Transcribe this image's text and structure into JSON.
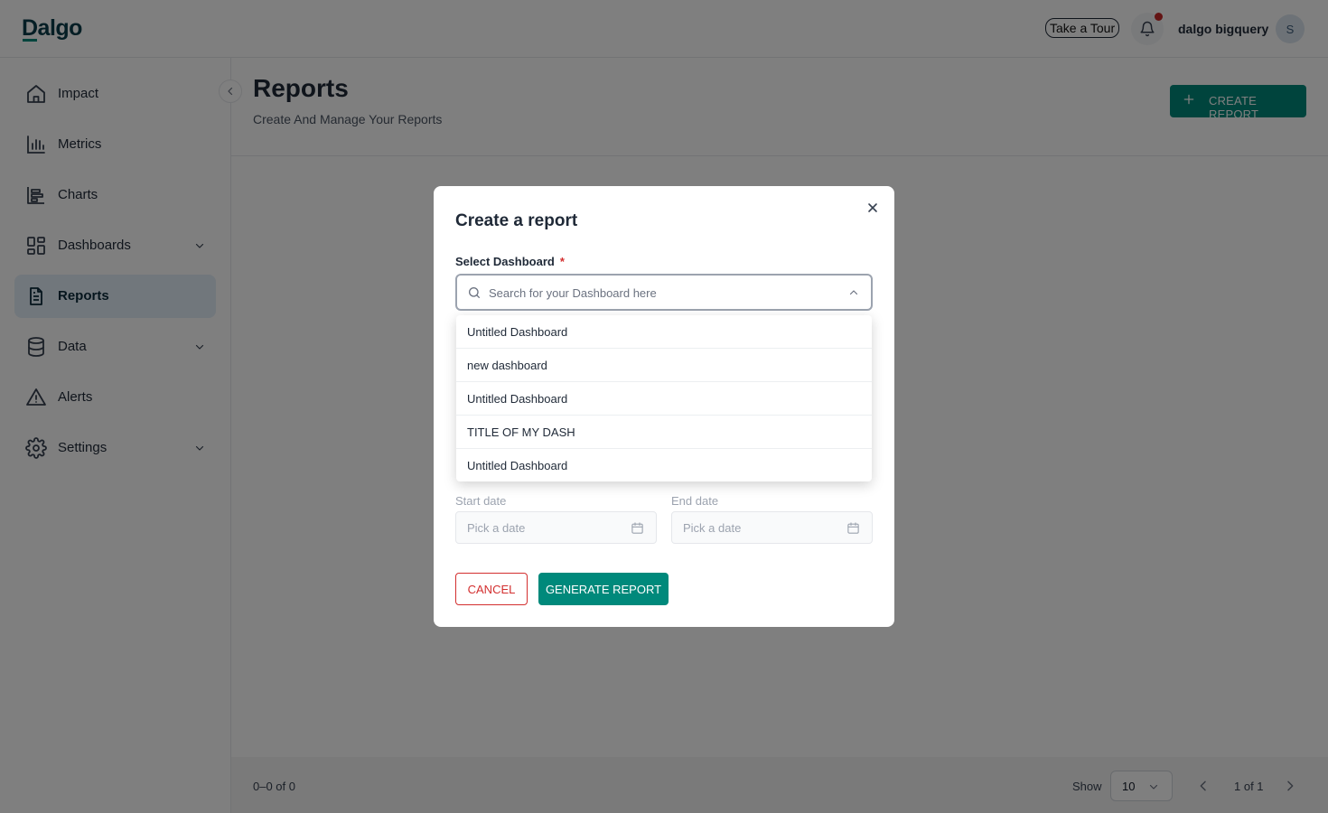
{
  "app": {
    "logo": "Dalgo"
  },
  "header": {
    "tour_label": "Take a Tour",
    "user_name": "dalgo bigquery",
    "avatar_initial": "S"
  },
  "sidebar": {
    "items": [
      {
        "label": "Impact",
        "icon": "home-icon",
        "has_chevron": false,
        "active": false
      },
      {
        "label": "Metrics",
        "icon": "bar-chart-icon",
        "has_chevron": false,
        "active": false
      },
      {
        "label": "Charts",
        "icon": "chart-icon",
        "has_chevron": false,
        "active": false
      },
      {
        "label": "Dashboards",
        "icon": "dashboard-icon",
        "has_chevron": true,
        "active": false
      },
      {
        "label": "Reports",
        "icon": "document-icon",
        "has_chevron": false,
        "active": true
      },
      {
        "label": "Data",
        "icon": "database-icon",
        "has_chevron": true,
        "active": false
      },
      {
        "label": "Alerts",
        "icon": "alert-icon",
        "has_chevron": false,
        "active": false
      },
      {
        "label": "Settings",
        "icon": "gear-icon",
        "has_chevron": true,
        "active": false
      }
    ]
  },
  "main": {
    "title": "Reports",
    "subtitle": "Create And Manage Your Reports",
    "create_button_label": "CREATE REPORT"
  },
  "footer": {
    "range_text": "0–0 of 0",
    "show_label": "Show",
    "show_value": "10",
    "page_info": "1 of 1"
  },
  "modal": {
    "title": "Create a report",
    "field_label": "Select Dashboard",
    "required_mark": "*",
    "search_placeholder": "Search for your Dashboard here",
    "options": [
      "Untitled Dashboard",
      "new dashboard",
      "Untitled Dashboard",
      "TITLE OF MY DASH",
      "Untitled Dashboard"
    ],
    "start_date_label": "Start date",
    "end_date_label": "End date",
    "date_placeholder": "Pick a date",
    "cancel_label": "CANCEL",
    "generate_label": "GENERATE REPORT"
  },
  "colors": {
    "accent": "#00897b",
    "brand": "#0b3d4a",
    "danger": "#d32f2f",
    "active_nav_bg": "#e3eef8"
  }
}
